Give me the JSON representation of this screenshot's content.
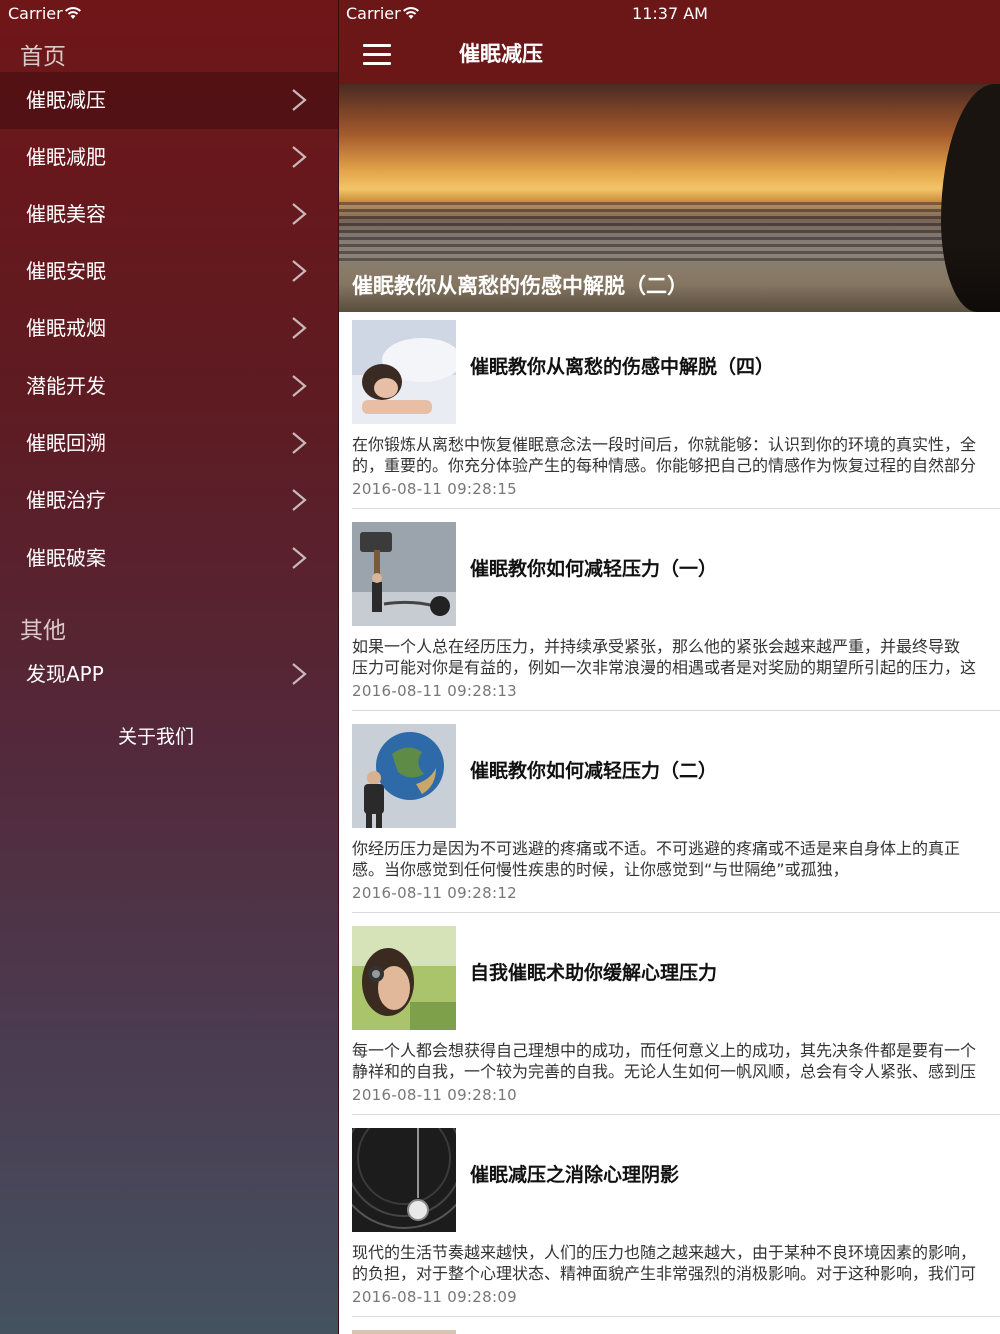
{
  "status_bar": {
    "carrier": "Carrier",
    "time": "11:37 AM"
  },
  "menu": {
    "home_section": "首页",
    "items": [
      {
        "label": "催眠减压"
      },
      {
        "label": "催眠减肥"
      },
      {
        "label": "催眠美容"
      },
      {
        "label": "催眠安眠"
      },
      {
        "label": "催眠戒烟"
      },
      {
        "label": "潜能开发"
      },
      {
        "label": "催眠回溯"
      },
      {
        "label": "催眠治疗"
      },
      {
        "label": "催眠破案"
      }
    ],
    "other_section": "其他",
    "other_items": [
      {
        "label": "发现APP"
      }
    ],
    "about": "关于我们"
  },
  "header": {
    "title": "催眠减压"
  },
  "banner": {
    "title": "催眠教你从离愁的伤感中解脱（二）"
  },
  "articles": [
    {
      "title": "催眠教你从离愁的伤感中解脱（四）",
      "summary_line1": "在你锻炼从离愁中恢复催眠意念法一段时间后，你就能够：认识到你的环境的真实性，全",
      "summary_line2": "的，重要的。你充分体验产生的每种情感。你能够把自己的情感作为恢复过程的自然部分",
      "date": "2016-08-11 09:28:15",
      "thumb_icon": "sleeping-woman-photo"
    },
    {
      "title": "催眠教你如何减轻压力（一）",
      "summary_line1": "如果一个人总在经历压力，并持续承受紧张，那么他的紧张会越来越严重，并最终导致",
      "summary_line2": "压力可能对你是有益的，例如一次非常浪漫的相遇或者是对奖励的期望所引起的压力，这",
      "date": "2016-08-11 09:28:13",
      "thumb_icon": "hammer-chain-photo"
    },
    {
      "title": "催眠教你如何减轻压力（二）",
      "summary_line1": "你经历压力是因为不可逃避的疼痛或不适。不可逃避的疼痛或不适是来自身体上的真正",
      "summary_line2": "感。当你感觉到任何慢性疾患的时候，让你感觉到“与世隔绝”或孤独，",
      "date": "2016-08-11 09:28:12",
      "thumb_icon": "man-carrying-globe-photo"
    },
    {
      "title": "自我催眠术助你缓解心理压力",
      "summary_line1": "每一个人都会想获得自己理想中的成功，而任何意义上的成功，其先决条件都是要有一个",
      "summary_line2": "静祥和的自我，一个较为完善的自我。无论人生如何一帆风顺，总会有令人紧张、感到压",
      "date": "2016-08-11 09:28:10",
      "thumb_icon": "woman-headphones-photo"
    },
    {
      "title": "催眠减压之消除心理阴影",
      "summary_line1": "现代的生活节奏越来越快，人们的压力也随之越来越大，由于某种不良环境因素的影响，",
      "summary_line2": "的负担，对于整个心理状态、精神面貌产生非常强烈的消极影响。对于这种影响，我们可",
      "date": "2016-08-11 09:28:09",
      "thumb_icon": "pocket-watch-photo"
    }
  ],
  "colors": {
    "navbar": "#6b1718",
    "menu_top": "#6f1618",
    "menu_bottom": "#44525f"
  }
}
